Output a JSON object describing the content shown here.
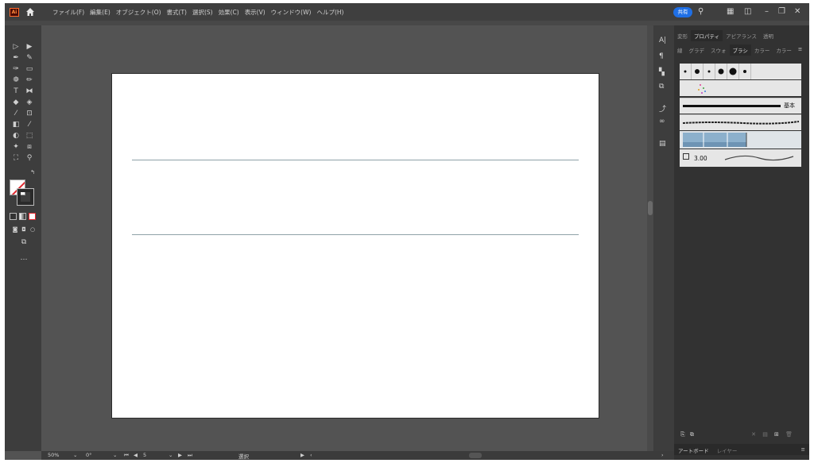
{
  "app": {
    "logo_text": "Ai",
    "accent": "#ff6a2a"
  },
  "menu": {
    "items": [
      "ファイル(F)",
      "編集(E)",
      "オブジェクト(O)",
      "書式(T)",
      "選択(S)",
      "効果(C)",
      "表示(V)",
      "ウィンドウ(W)",
      "ヘルプ(H)"
    ]
  },
  "top_right": {
    "share_label": "共有",
    "share_color": "#1f6fe5"
  },
  "panel": {
    "tabs": [
      "変形",
      "プロパティ",
      "アピアランス",
      "透明"
    ],
    "active_tab": "プロパティ",
    "tabs2": [
      "線",
      "グラデ",
      "スウォ",
      "ブラシ",
      "カラー",
      "カラー"
    ],
    "active_tab2": "ブラシ",
    "basic_label": "基本",
    "stroke_size": "3.00",
    "bottom_tabs": [
      "アートボード",
      "レイヤー"
    ]
  },
  "status": {
    "zoom": "50%",
    "rotation": "0°",
    "artboard_number": "5",
    "tool_name": "選択"
  }
}
